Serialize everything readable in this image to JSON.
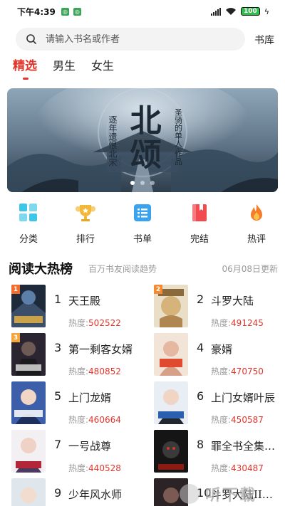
{
  "status_bar": {
    "time": "下午4:39",
    "battery": "100"
  },
  "search": {
    "placeholder": "请输入书名或作者",
    "library": "书库"
  },
  "tabs": [
    {
      "label": "精选",
      "active": true
    },
    {
      "label": "男生",
      "active": false
    },
    {
      "label": "女生",
      "active": false
    }
  ],
  "banner": {
    "title": "北颂",
    "tagline": "逐年遗恨北宋",
    "credit": "圣骑的单人·作品",
    "dots": 3,
    "active_dot": 0
  },
  "quick_nav": [
    {
      "label": "分类",
      "icon": "category-icon",
      "color": "#3cc7e8"
    },
    {
      "label": "排行",
      "icon": "trophy-icon",
      "color": "#f2b83b"
    },
    {
      "label": "书单",
      "icon": "list-icon",
      "color": "#3aa3f0"
    },
    {
      "label": "完结",
      "icon": "book-icon",
      "color": "#ef4b50"
    },
    {
      "label": "热评",
      "icon": "fire-icon",
      "color": "#f57c2a"
    }
  ],
  "rank": {
    "title": "阅读大热榜",
    "subtitle": "百万书友阅读趋势",
    "date": "06月08日更新",
    "heat_label": "热度:",
    "books": [
      {
        "rank": "1",
        "title": "天王殿",
        "heat": "502522",
        "badge_color": "#f46b2c"
      },
      {
        "rank": "2",
        "title": "斗罗大陆",
        "heat": "491245",
        "badge_color": "#f58a2e"
      },
      {
        "rank": "3",
        "title": "第一剩客女婿",
        "heat": "480852",
        "badge_color": "#f6a43a"
      },
      {
        "rank": "4",
        "title": "豪婿",
        "heat": "470750"
      },
      {
        "rank": "5",
        "title": "上门龙婿",
        "heat": "460664"
      },
      {
        "rank": "6",
        "title": "上门女婿叶辰",
        "heat": "450587"
      },
      {
        "rank": "7",
        "title": "一号战尊",
        "heat": "440528"
      },
      {
        "rank": "8",
        "title": "罪全书全集…",
        "heat": "430487"
      },
      {
        "rank": "9",
        "title": "少年风水师",
        "heat": ""
      },
      {
        "rank": "10",
        "title": "斗罗大陆II…",
        "heat": ""
      }
    ]
  },
  "watermark": {
    "text": "听下载"
  },
  "colors": {
    "accent": "#e0362c",
    "muted": "#999999"
  }
}
